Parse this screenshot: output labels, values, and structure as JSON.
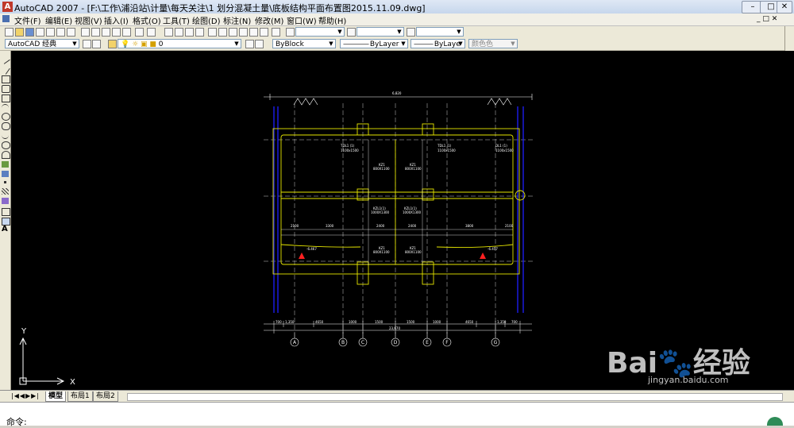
{
  "window": {
    "title": "AutoCAD 2007 - [F:\\工作\\浦沿站\\计量\\每天关注\\1 划分混凝土量\\底板结构平面布置图2015.11.09.dwg]"
  },
  "menu": [
    "文件(F)",
    "编辑(E)",
    "视图(V)",
    "插入(I)",
    "格式(O)",
    "工具(T)",
    "绘图(D)",
    "标注(N)",
    "修改(M)",
    "窗口(W)",
    "帮助(H)"
  ],
  "toolbar": {
    "workspace": "AutoCAD 经典",
    "layer": "0",
    "color": "ByBlock",
    "linetype": "ByLayer",
    "lineweight": "ByLaye",
    "plotstyle": "颜色色"
  },
  "colors": {
    "axis_yellow": "#e5e500",
    "dim_white": "#ffffff",
    "blue_col": "#1e1eff",
    "red_mark": "#ff2020"
  },
  "drawing": {
    "axis_labels": [
      "A",
      "B",
      "C",
      "D",
      "E",
      "F",
      "G"
    ],
    "top_dim": "6,820",
    "dims_row1": [
      "700",
      "1,350",
      "4650",
      "1000",
      "1500",
      "1500",
      "1000",
      "4650",
      "1,350",
      "700"
    ],
    "total_dim": "23,670",
    "beams": [
      "TDL1 (1)",
      "KZ1",
      "KZ1",
      "TDL1 (1)",
      "DL1 (1)"
    ],
    "beam_sizes": [
      "1100x1500",
      "800X1100",
      "800X1100",
      "1100x1500",
      "1100x1500"
    ],
    "mid_labels": [
      "KZL1(1)",
      "KZL1(1)"
    ],
    "mid_sizes": [
      "1000X1300",
      "1000X1300"
    ],
    "lower_kz": [
      "KZ1",
      "KZ1"
    ],
    "lower_sizes": [
      "800X1100",
      "800X1100"
    ],
    "elevations": [
      "-6.467",
      "-6.457"
    ],
    "spans": [
      "2100",
      "3300",
      "2400",
      "2400",
      "3800",
      "2100"
    ],
    "ucs_x": "X",
    "ucs_y": "Y"
  },
  "tabs": [
    "模型",
    "布局1",
    "布局2"
  ],
  "command": {
    "prompt": "命令:"
  },
  "watermark": {
    "logo": "Bai",
    "text": "经验",
    "url": "jingyan.baidu.com"
  }
}
